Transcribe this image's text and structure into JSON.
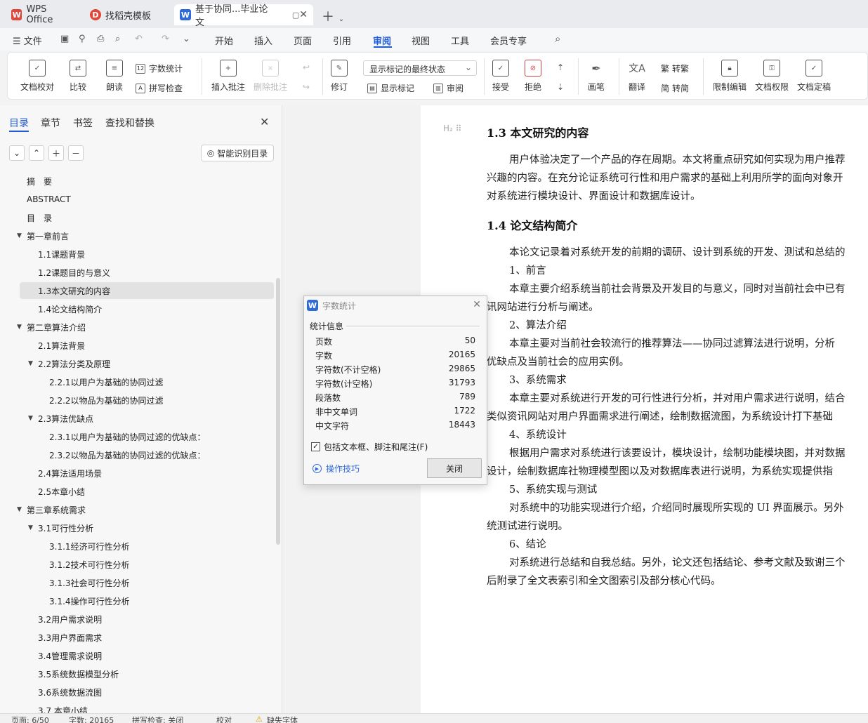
{
  "tabs": [
    {
      "label": "WPS Office",
      "icon": "wps-logo"
    },
    {
      "label": "找稻壳模板",
      "icon": "docer-logo"
    },
    {
      "label": "基于协同...毕业论文",
      "icon": "writer-logo"
    }
  ],
  "menu": {
    "file": "文件",
    "items": [
      "开始",
      "插入",
      "页面",
      "引用",
      "审阅",
      "视图",
      "工具",
      "会员专享"
    ],
    "active": "审阅"
  },
  "ribbon": {
    "proofread": "文档校对",
    "compare": "比较",
    "read_aloud": "朗读",
    "word_count": "字数统计",
    "spell_check": "拼写检查",
    "insert_comment": "插入批注",
    "delete_comment": "删除批注",
    "revise": "修订",
    "markup_state": "显示标记的最终状态",
    "show_markup": "显示标记",
    "review": "审阅",
    "accept": "接受",
    "reject": "拒绝",
    "ink": "画笔",
    "translate": "翻译",
    "to_traditional": "转繁",
    "to_simplified": "转简",
    "restrict_edit": "限制编辑",
    "doc_permission": "文档权限",
    "doc_finalize": "文档定稿"
  },
  "nav": {
    "tabs": [
      "目录",
      "章节",
      "书签",
      "查找和替换"
    ],
    "smart_toc": "智能识别目录",
    "toc": [
      {
        "label": "摘　要",
        "level": 1,
        "arrow": false
      },
      {
        "label": "ABSTRACT",
        "level": 1,
        "arrow": false
      },
      {
        "label": "目　录",
        "level": 1,
        "arrow": false
      },
      {
        "label": "第一章前言",
        "level": 1,
        "arrow": true
      },
      {
        "label": "1.1课题背景",
        "level": 2,
        "arrow": false
      },
      {
        "label": "1.2课题目的与意义",
        "level": 2,
        "arrow": false
      },
      {
        "label": "1.3本文研究的内容",
        "level": 2,
        "arrow": false,
        "selected": true
      },
      {
        "label": "1.4论文结构简介",
        "level": 2,
        "arrow": false
      },
      {
        "label": "第二章算法介绍",
        "level": 1,
        "arrow": true
      },
      {
        "label": "2.1算法背景",
        "level": 2,
        "arrow": false
      },
      {
        "label": "2.2算法分类及原理",
        "level": 2,
        "arrow": true
      },
      {
        "label": "2.2.1以用户为基础的协同过滤",
        "level": 3,
        "arrow": false
      },
      {
        "label": "2.2.2以物品为基础的协同过滤",
        "level": 3,
        "arrow": false
      },
      {
        "label": "2.3算法优缺点",
        "level": 2,
        "arrow": true
      },
      {
        "label": "2.3.1以用户为基础的协同过滤的优缺点：",
        "level": 3,
        "arrow": false
      },
      {
        "label": "2.3.2以物品为基础的协同过滤的优缺点：",
        "level": 3,
        "arrow": false
      },
      {
        "label": "2.4算法适用场景",
        "level": 2,
        "arrow": false
      },
      {
        "label": "2.5本章小结",
        "level": 2,
        "arrow": false
      },
      {
        "label": "第三章系统需求",
        "level": 1,
        "arrow": true
      },
      {
        "label": "3.1可行性分析",
        "level": 2,
        "arrow": true
      },
      {
        "label": "3.1.1经济可行性分析",
        "level": 3,
        "arrow": false
      },
      {
        "label": "3.1.2技术可行性分析",
        "level": 3,
        "arrow": false
      },
      {
        "label": "3.1.3社会可行性分析",
        "level": 3,
        "arrow": false
      },
      {
        "label": "3.1.4操作可行性分析",
        "level": 3,
        "arrow": false
      },
      {
        "label": "3.2用户需求说明",
        "level": 2,
        "arrow": false
      },
      {
        "label": "3.3用户界面需求",
        "level": 2,
        "arrow": false
      },
      {
        "label": "3.4管理需求说明",
        "level": 2,
        "arrow": false
      },
      {
        "label": "3.5系统数据模型分析",
        "level": 2,
        "arrow": false
      },
      {
        "label": "3.6系统数据流图",
        "level": 2,
        "arrow": false
      },
      {
        "label": "3.7 本章小结",
        "level": 2,
        "arrow": false
      }
    ]
  },
  "document": {
    "lines": [
      {
        "type": "h",
        "text": "1.3  本文研究的内容"
      },
      {
        "type": "p",
        "indent": true,
        "text": "用户体验决定了一个产品的存在周期。本文将重点研究如何实现为用户推荐"
      },
      {
        "type": "p",
        "indent": false,
        "text": "兴趣的内容。在充分论证系统可行性和用户需求的基础上利用所学的面向对象开"
      },
      {
        "type": "p",
        "indent": false,
        "text": "对系统进行模块设计、界面设计和数据库设计。"
      },
      {
        "type": "h",
        "text": "1.4  论文结构简介"
      },
      {
        "type": "p",
        "indent": true,
        "text": "本论文记录着对系统开发的前期的调研、设计到系统的开发、测试和总结的"
      },
      {
        "type": "p",
        "indent": true,
        "text": "1、前言"
      },
      {
        "type": "p",
        "indent": true,
        "text": "本章主要介绍系统当前社会背景及开发目的与意义，同时对当前社会中已有"
      },
      {
        "type": "p",
        "indent": false,
        "text": "讯网站进行分析与阐述。"
      },
      {
        "type": "p",
        "indent": true,
        "text": "2、算法介绍"
      },
      {
        "type": "p",
        "indent": true,
        "text": "本章主要对当前社会较流行的推荐算法——协同过滤算法进行说明，分析"
      },
      {
        "type": "p",
        "indent": false,
        "text": "优缺点及当前社会的应用实例。"
      },
      {
        "type": "p",
        "indent": true,
        "text": "3、系统需求"
      },
      {
        "type": "p",
        "indent": true,
        "text": "本章主要对系统进行开发的可行性进行分析，并对用户需求进行说明，结合"
      },
      {
        "type": "p",
        "indent": false,
        "text": "类似资讯网站对用户界面需求进行阐述，绘制数据流图，为系统设计打下基础"
      },
      {
        "type": "p",
        "indent": true,
        "text": "4、系统设计"
      },
      {
        "type": "p",
        "indent": true,
        "text": "根据用户需求对系统进行该要设计，模块设计，绘制功能模块图，并对数据"
      },
      {
        "type": "p",
        "indent": false,
        "text": "设计，绘制数据库社物理模型图以及对数据库表进行说明，为系统实现提供指"
      },
      {
        "type": "p",
        "indent": true,
        "text": "5、系统实现与测试"
      },
      {
        "type": "p",
        "indent": true,
        "text": "对系统中的功能实现进行介绍，介绍同时展现所实现的 UI 界面展示。另外"
      },
      {
        "type": "p",
        "indent": false,
        "text": "统测试进行说明。"
      },
      {
        "type": "p",
        "indent": true,
        "text": "6、结论"
      },
      {
        "type": "p",
        "indent": true,
        "text": "对系统进行总结和自我总结。另外，论文还包括结论、参考文献及致谢三个"
      },
      {
        "type": "p",
        "indent": false,
        "text": "后附录了全文表索引和全文图索引及部分核心代码。"
      }
    ]
  },
  "dialog": {
    "title": "字数统计",
    "group": "统计信息",
    "stats": [
      {
        "label": "页数",
        "value": "50"
      },
      {
        "label": "字数",
        "value": "20165"
      },
      {
        "label": "字符数(不计空格)",
        "value": "29865"
      },
      {
        "label": "字符数(计空格)",
        "value": "31793"
      },
      {
        "label": "段落数",
        "value": "789"
      },
      {
        "label": "非中文单词",
        "value": "1722"
      },
      {
        "label": "中文字符",
        "value": "18443"
      }
    ],
    "include_label": "包括文本框、脚注和尾注(F)",
    "include_checked": true,
    "tips": "操作技巧",
    "close": "关闭"
  },
  "status": {
    "page": "页面: 6/50",
    "words": "字数: 20165",
    "spell": "拼写检查: 关闭",
    "proof": "校对",
    "missing_font": "缺失字体"
  },
  "colors": {
    "accent": "#1f5bd6",
    "wps_red": "#e0463a",
    "writer_blue": "#2f6ad9"
  }
}
